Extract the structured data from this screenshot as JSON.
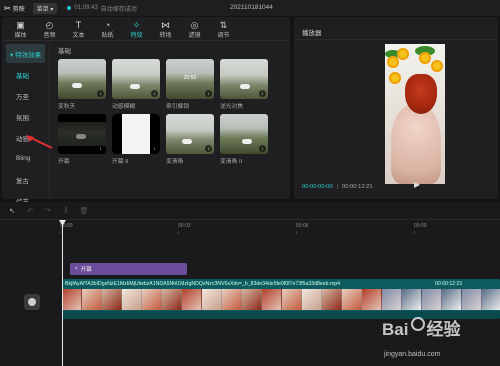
{
  "app": {
    "name": "剪映",
    "menu_label": "菜单",
    "save_time": "01:09:43",
    "save_status": "自动保存成功",
    "project_title": "202110181044"
  },
  "toolbar": {
    "tools": [
      {
        "label": "媒体",
        "icon": "media-icon"
      },
      {
        "label": "音频",
        "icon": "audio-icon"
      },
      {
        "label": "文本",
        "icon": "text-icon"
      },
      {
        "label": "贴纸",
        "icon": "sticker-icon"
      },
      {
        "label": "特效",
        "icon": "effects-icon"
      },
      {
        "label": "转场",
        "icon": "transition-icon"
      },
      {
        "label": "滤镜",
        "icon": "filter-icon"
      },
      {
        "label": "调节",
        "icon": "adjust-icon"
      }
    ],
    "active_index": 4
  },
  "sidebar": {
    "header": "▾ 特效效果",
    "items": [
      "基础",
      "万圣",
      "氛围",
      "动感",
      "Bling",
      "复古",
      "综艺"
    ],
    "selected_index": 0
  },
  "gallery": {
    "section_title": "基础",
    "cards": [
      {
        "label": "变秋天",
        "style": "t-field"
      },
      {
        "label": "动感模糊",
        "style": "t-field2"
      },
      {
        "label": "牵引解锁",
        "style": "t-field"
      },
      {
        "label": "逆光对焦",
        "style": "t-field2"
      },
      {
        "label": "开幕",
        "style": "t-dark"
      },
      {
        "label": "开幕 II",
        "style": "t-white"
      },
      {
        "label": "变清晰",
        "style": "t-field2"
      },
      {
        "label": "变清晰 II",
        "style": "t-field"
      }
    ]
  },
  "player": {
    "title": "播放器",
    "current_time": "00:00:00:00",
    "separator": "|",
    "total_time": "00:00:12:21"
  },
  "timeline": {
    "ruler_labels": [
      "00:00",
      "00:03",
      "00:06",
      "00:09"
    ],
    "effect_clip_label": "开幕",
    "video_clip_name": "BkjfAyAfTA3bIDgxNzE1MzIiMjUtwbzA1NDA5Nhl1MzIgNDQxNzc3NV6xXdv=_b_83de34de5fe0f0f7e73f5a33d8eeb.mp4",
    "video_clip_duration": "00:00:12:21"
  },
  "watermark": {
    "brand": "Bai",
    "brand_suffix": "经验",
    "url": "jingyan.baidu.com"
  }
}
